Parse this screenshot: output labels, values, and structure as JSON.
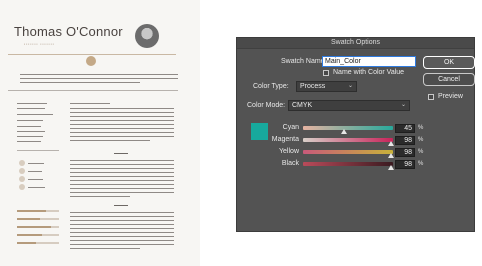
{
  "resume": {
    "name": "Thomas O'Connor"
  },
  "dialog": {
    "title": "Swatch Options",
    "swatch_name_label": "Swatch Name:",
    "swatch_name_value": "Main_Color",
    "name_with_color_value_label": "Name with Color Value",
    "color_type_label": "Color Type:",
    "color_type_value": "Process",
    "color_mode_label": "Color Mode:",
    "color_mode_value": "CMYK",
    "ok_label": "OK",
    "cancel_label": "Cancel",
    "preview_label": "Preview",
    "swatch_color": "#17a99d",
    "channels": [
      {
        "label": "Cyan",
        "value": "45",
        "unit": "%",
        "level": 0.45
      },
      {
        "label": "Magenta",
        "value": "98",
        "unit": "%",
        "level": 0.98
      },
      {
        "label": "Yellow",
        "value": "98",
        "unit": "%",
        "level": 0.98
      },
      {
        "label": "Black",
        "value": "98",
        "unit": "%",
        "level": 0.98
      }
    ]
  }
}
